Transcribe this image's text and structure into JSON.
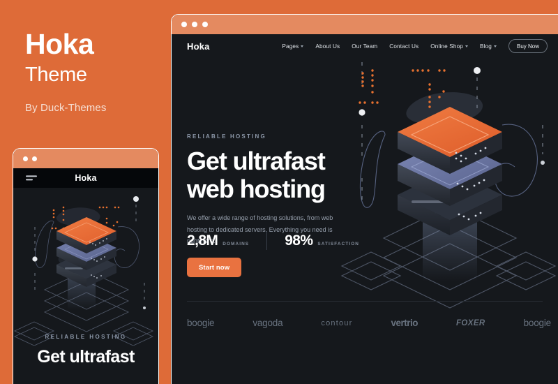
{
  "promo": {
    "title": "Hoka",
    "subtitle": "Theme",
    "author": "By Duck-Themes"
  },
  "colors": {
    "background_orange": "#DE6B38",
    "chrome_orange": "#E48A60",
    "dark_panel": "#15181C",
    "accent_button": "#E97240",
    "muted_text": "#98A1AE"
  },
  "desktop": {
    "window_dots": [
      "dot-1",
      "dot-2",
      "dot-3"
    ],
    "logo": "Hoka",
    "nav": [
      {
        "label": "Pages",
        "has_dropdown": true
      },
      {
        "label": "About Us",
        "has_dropdown": false
      },
      {
        "label": "Our Team",
        "has_dropdown": false
      },
      {
        "label": "Contact Us",
        "has_dropdown": false
      },
      {
        "label": "Online Shop",
        "has_dropdown": true
      },
      {
        "label": "Blog",
        "has_dropdown": true
      }
    ],
    "buy_button": "Buy Now",
    "hero": {
      "eyebrow": "RELIABLE HOSTING",
      "heading_line1": "Get ultrafast",
      "heading_line2": "web hosting",
      "paragraph": "We offer a wide range of hosting solutions, from web hosting to dedicated servers. Everything you need is right here.",
      "cta": "Start now"
    },
    "stats": [
      {
        "value": "2,8M",
        "label": "DOMAINS"
      },
      {
        "value": "98%",
        "label": "SATISFACTION"
      }
    ],
    "brands": [
      "boogie",
      "vagoda",
      "contour",
      "vertrio",
      "FOXER",
      "boogie"
    ]
  },
  "mobile": {
    "window_dots": [
      "dot-1",
      "dot-2"
    ],
    "menu_icon": "hamburger-icon",
    "logo": "Hoka",
    "eyebrow": "RELIABLE HOSTING",
    "heading": "Get ultrafast"
  }
}
